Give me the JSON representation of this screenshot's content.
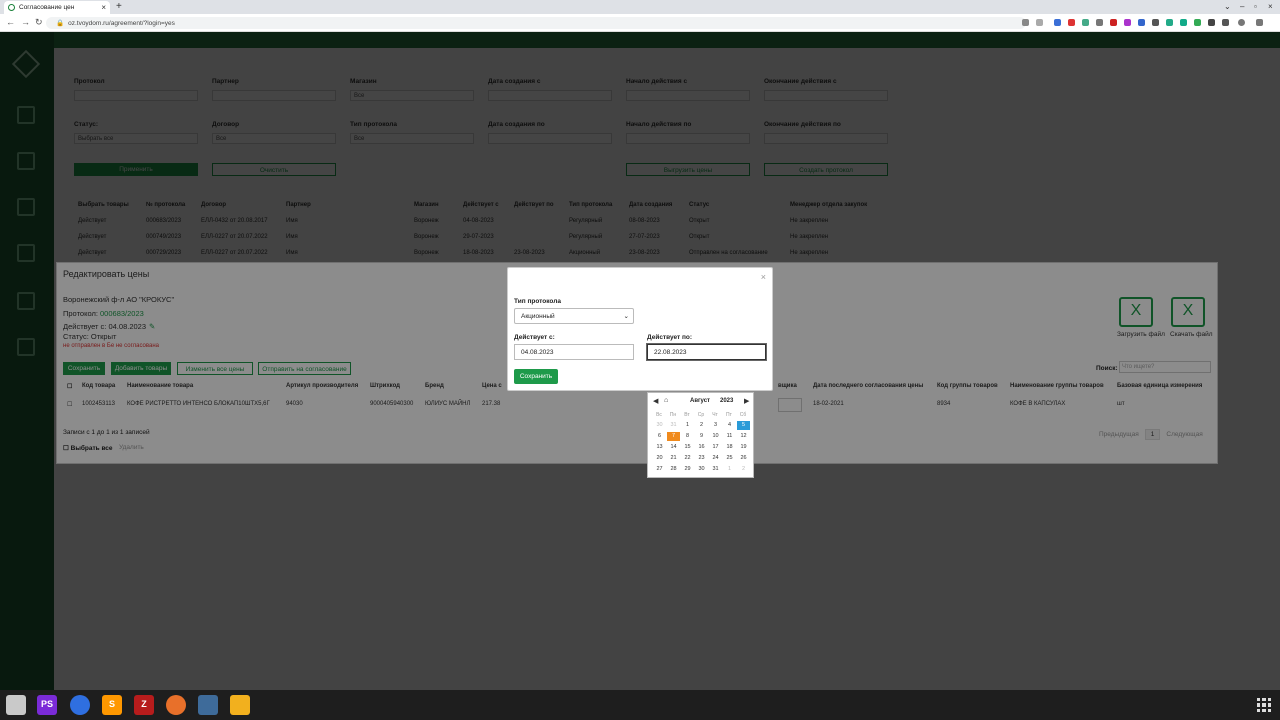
{
  "browser": {
    "tab_title": "Согласование цен",
    "url": "oz.tvoydom.ru/agreement/?login=yes"
  },
  "filters": {
    "protocol_label": "Протокол",
    "partner_label": "Партнер",
    "store_label": "Магазин",
    "store_value": "Все",
    "created_from_label": "Дата создания с",
    "start_from_label": "Начало действия с",
    "end_from_label": "Окончание действия с",
    "status_label": "Статус:",
    "status_value": "Выбрать все",
    "contract_label": "Договор",
    "contract_value": "Все",
    "protocol_type_label": "Тип протокола",
    "protocol_type_value": "Все",
    "created_to_label": "Дата создания по",
    "start_to_label": "Начало действия по",
    "end_to_label": "Окончание действия по",
    "apply": "Применить",
    "clear": "Очистить",
    "export": "Выгрузить цены",
    "create": "Создать протокол"
  },
  "protocols_table": {
    "headers": [
      "Выбрать товары",
      "№ протокола",
      "Договор",
      "Партнер",
      "Магазин",
      "Действует с",
      "Действует по",
      "Тип протокола",
      "Дата создания",
      "Статус",
      "Менеджер отдела закупок"
    ],
    "rows": [
      [
        "Действует",
        "000683/2023",
        "ЕЛЛ-0432 от 20.08.2017",
        "Имя",
        "Воронеж",
        "04-08-2023",
        "",
        "Регулярный",
        "08-08-2023",
        "Открыт",
        "Не закреплен"
      ],
      [
        "Действует",
        "000749/2023",
        "ЕЛЛ-0227 от 20.07.2022",
        "Имя",
        "Воронеж",
        "29-07-2023",
        "",
        "Регулярный",
        "27-07-2023",
        "Открыт",
        "Не закреплен"
      ],
      [
        "Действует",
        "000729/2023",
        "ЕЛЛ-0227 от 20.07.2022",
        "Имя",
        "Воронеж",
        "18-08-2023",
        "23-08-2023",
        "Акционный",
        "23-08-2023",
        "Отправлен на согласование",
        "Не закреплен"
      ]
    ]
  },
  "panel": {
    "title": "Редактировать цены",
    "org": "Воронежский ф-л АО \"КРОКУС\"",
    "protocol_label": "Протокол:",
    "protocol_num": "000683/2023",
    "valid_from": "Действует с: 04.08.2023",
    "status": "Статус: Открыт",
    "warning": "не отправлен в Бе не согласована",
    "buttons": [
      "Сохранить",
      "Добавить товары",
      "Изменить все цены",
      "Отправить на согласование"
    ],
    "upload": "Загрузить файл",
    "download": "Скачать файл",
    "search_label": "Поиск:",
    "search_placeholder": "Что ищете?",
    "headers": [
      "Код товара",
      "Наименование товара",
      "Артикул производителя",
      "Штрихкод",
      "Бренд",
      "Цена с",
      "вщика",
      "Дата последнего согласования цены",
      "Код группы товаров",
      "Наименование группы товаров",
      "Базовая единица измерения"
    ],
    "row": [
      "1002453113",
      "КОФЕ РИСТРЕТТО ИНТЕНСО БЛОКАП10ШТХ5,6Г",
      "94030",
      "9000405940300",
      "ЮЛИУС МАЙНЛ",
      "217.38",
      "",
      "18-02-2021",
      "8934",
      "КОФЕ В КАПСУЛАХ",
      "шт"
    ],
    "records": "Записи с 1 до 1 из 1 записей",
    "select_all": "Выбрать все",
    "delete": "Удалить",
    "prev": "Предыдущая",
    "page": "1",
    "next": "Следующая"
  },
  "modal": {
    "type_label": "Тип протокола",
    "type_value": "Акционный",
    "from_label": "Действует с:",
    "from_value": "04.08.2023",
    "to_label": "Действует по:",
    "to_value": "22.08.2023",
    "save": "Сохранить"
  },
  "datepicker": {
    "month": "Август",
    "year": "2023",
    "dow": [
      "Вс",
      "Пн",
      "Вт",
      "Ср",
      "Чт",
      "Пт",
      "Сб"
    ],
    "weeks": [
      [
        "30",
        "31",
        "1",
        "2",
        "3",
        "4",
        "5"
      ],
      [
        "6",
        "7",
        "8",
        "9",
        "10",
        "11",
        "12"
      ],
      [
        "13",
        "14",
        "15",
        "16",
        "17",
        "18",
        "19"
      ],
      [
        "20",
        "21",
        "22",
        "23",
        "24",
        "25",
        "26"
      ],
      [
        "27",
        "28",
        "29",
        "30",
        "31",
        "1",
        "2"
      ]
    ],
    "selected": "5",
    "hover": "7"
  },
  "taskbar": {
    "items": [
      "files",
      "phpstorm",
      "chrome",
      "sublime",
      "filezilla",
      "firefox",
      "virtualbox",
      "editor"
    ]
  },
  "colors": {
    "brand_green": "#1e9a4a",
    "sidebar": "#1f5c34",
    "selected_day": "#2a9bd8",
    "hover_day": "#f08a1c"
  }
}
